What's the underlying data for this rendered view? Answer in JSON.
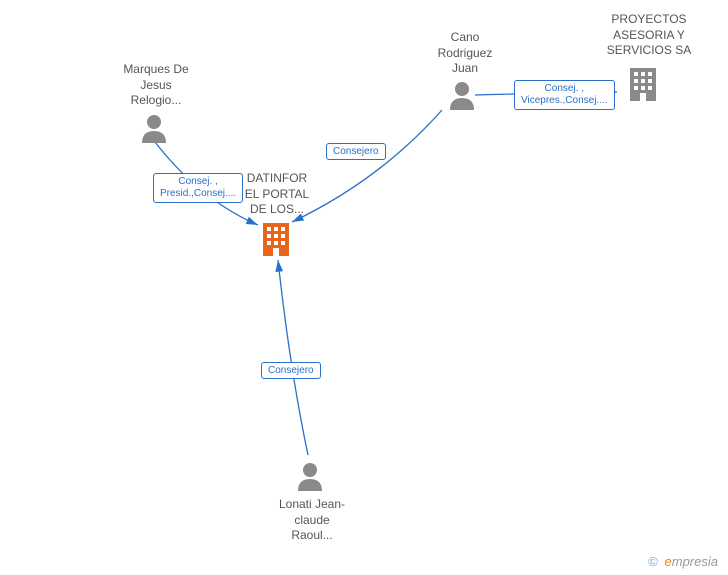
{
  "nodes": {
    "marques": {
      "label": "Marques De\nJesus\nRelogio..."
    },
    "cano": {
      "label": "Cano\nRodriguez\nJuan"
    },
    "lonati": {
      "label": "Lonati Jean-\nclaude\nRaoul..."
    },
    "datinfor": {
      "label": "DATINFOR\nEL PORTAL\nDE LOS..."
    },
    "proyectos": {
      "label": "PROYECTOS\nASESORIA Y\nSERVICIOS SA"
    }
  },
  "edges": {
    "marques_datinfor": {
      "label": "Consej. ,\nPresid.,Consej...."
    },
    "cano_datinfor": {
      "label": "Consejero"
    },
    "cano_proyectos": {
      "label": "Consej. ,\nVicepres.,Consej...."
    },
    "lonati_datinfor": {
      "label": "Consejero"
    }
  },
  "watermark": {
    "copy": "©",
    "brand_e": "e",
    "brand_rest": "mpresia"
  }
}
